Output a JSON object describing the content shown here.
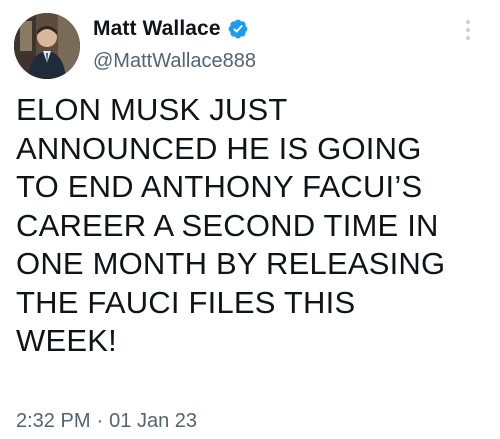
{
  "tweet": {
    "author": {
      "display_name": "Matt Wallace",
      "handle": "@MattWallace888",
      "verified": true
    },
    "text_lines": [
      "ELON MUSK JUST",
      "ANNOUNCED HE IS GOING",
      "TO END ANTHONY FACUI’S",
      "CAREER A SECOND TIME IN",
      "ONE MONTH BY RELEASING",
      "THE FAUCI FILES THIS",
      "WEEK!"
    ],
    "time": "2:32 PM",
    "separator": "·",
    "date": "01 Jan 23"
  },
  "icons": {
    "verified": "verified-badge-icon",
    "more": "more-vertical-icon"
  },
  "colors": {
    "verified_blue": "#1d9bf0",
    "text": "#0f1419",
    "secondary_text": "#536471"
  }
}
